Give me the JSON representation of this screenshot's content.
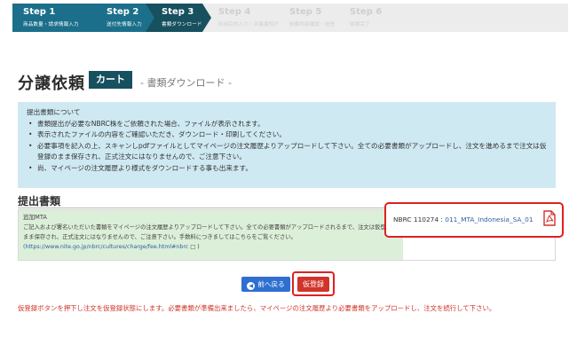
{
  "stepper": {
    "steps": [
      {
        "title": "Step 1",
        "sub": "商品数量・請求情報入力",
        "state": "done"
      },
      {
        "title": "Step 2",
        "sub": "送付先情報入力",
        "state": "done"
      },
      {
        "title": "Step 3",
        "sub": "書類ダウンロード",
        "state": "active"
      },
      {
        "title": "Step 4",
        "sub": "利用目的入力・到着最短日",
        "state": "future"
      },
      {
        "title": "Step 5",
        "sub": "依頼内容確認・送信",
        "state": "future"
      },
      {
        "title": "Step 6",
        "sub": "依頼完了",
        "state": "future"
      }
    ],
    "colors": {
      "done": "#1b6f8a",
      "active": "#17505f",
      "future": "#ececec"
    }
  },
  "header": {
    "title": "分譲依頼",
    "badge": "カート",
    "subtitle": "- 書類ダウンロード -"
  },
  "info": {
    "heading": "提出書類について",
    "bullets": [
      "書類提出が必要なNBRC株をご依頼された場合、ファイルが表示されます。",
      "表示されたファイルの内容をご確認いただき、ダウンロード・印刷してください。",
      "必要事項を記入の上、スキャンしpdfファイルとしてマイページの注文履歴よりアップロードして下さい。全ての必要書類がアップロードし、注文を進めるまで注文は仮登録のまま保存され、正式注文にはなりませんので、ご注意下さい。",
      "尚、マイページの注文履歴より様式をダウンロードする事も出来ます。"
    ]
  },
  "section": {
    "title": "提出書類"
  },
  "document": {
    "label": "追加MTA",
    "description": "ご記入および署名いただいた書類をマイページの注文履歴よりアップロードして下さい。全ての必要書類がアップロードされるまで、注文は仮登録のまま保存され、正式注文にはなりませんので、ご注意下さい。手数料につきましてはこちらをご覧ください。",
    "url": "(https://www.nite.go.jp/nbrc/cultures/charge/fee.html#nbrc",
    "url_suffix": "□ )",
    "strain": "NBRC 110274 : ",
    "file_name": "011_MTA_Indonesia_SA_01"
  },
  "buttons": {
    "back": "前へ戻る",
    "register": "仮登録"
  },
  "notice": "仮登録ボタンを押下し注文を仮登録状態にします。必要書類が準備出来ましたら、マイページの注文履歴より必要書類をアップロードし、注文を続行して下さい。"
}
